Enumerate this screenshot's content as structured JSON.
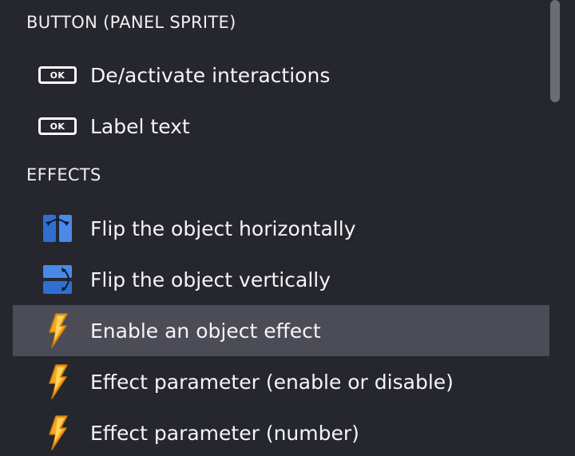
{
  "sections": [
    {
      "title": "BUTTON (PANEL SPRITE)",
      "items": [
        {
          "label": "De/activate interactions",
          "icon": "ok-button-icon",
          "icon_text": "OK"
        },
        {
          "label": "Label text",
          "icon": "ok-button-icon",
          "icon_text": "OK"
        }
      ]
    },
    {
      "title": "EFFECTS",
      "items": [
        {
          "label": "Flip the object horizontally",
          "icon": "flip-horizontal-icon"
        },
        {
          "label": "Flip the object vertically",
          "icon": "flip-vertical-icon"
        },
        {
          "label": "Enable an object effect",
          "icon": "lightning-bolt-icon",
          "selected": true
        },
        {
          "label": "Effect parameter (enable or disable)",
          "icon": "lightning-bolt-icon"
        },
        {
          "label": "Effect parameter (number)",
          "icon": "lightning-bolt-icon"
        }
      ]
    }
  ],
  "colors": {
    "background": "#25262e",
    "selected_row": "#4b4c56",
    "scrollbar_thumb": "#6b6c74",
    "flip_blue": "#3d7fd9",
    "bolt_orange": "#f5a623"
  }
}
